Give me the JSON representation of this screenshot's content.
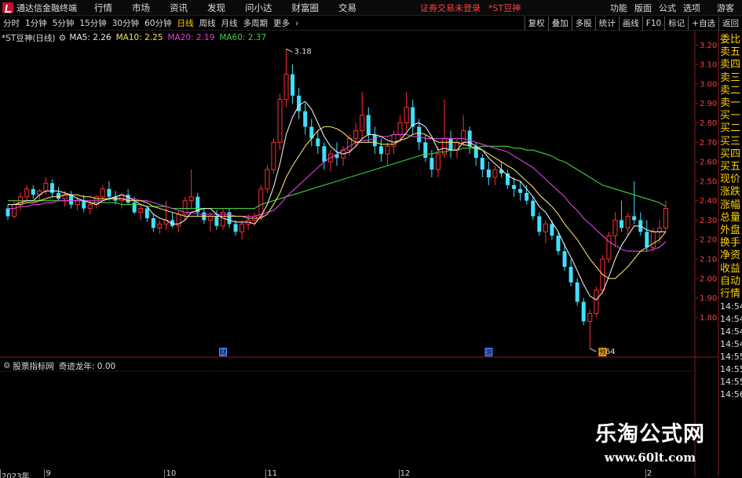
{
  "menubar": {
    "app_title": "通达信金融终端",
    "items": [
      "行情",
      "市场",
      "资讯",
      "发现",
      "问小达",
      "财富圈",
      "交易"
    ],
    "status_msg": "证券交易未登录",
    "stock_title": "*ST豆神",
    "right_items": [
      "功能",
      "版面",
      "公式",
      "选项"
    ],
    "guest": "游客"
  },
  "toolbar": {
    "periods": [
      "分时",
      "1分钟",
      "5分钟",
      "15分钟",
      "30分钟",
      "60分钟",
      "日线",
      "周线",
      "月线",
      "多周期",
      "更多"
    ],
    "active_period": "日线",
    "right_buttons": [
      "复权",
      "叠加",
      "多股",
      "统计",
      "画线",
      "F10",
      "标记",
      "+自选",
      "返回"
    ]
  },
  "legend": {
    "code": "*ST豆神(日线)",
    "ma5_label": "MA5: 2.26",
    "ma10_label": "MA10: 2.25",
    "ma20_label": "MA20: 2.19",
    "ma60_label": "MA60: 2.37",
    "ma5_color": "#e8e8e8",
    "ma10_color": "#f0e060",
    "ma20_color": "#e040e0",
    "ma60_color": "#40d040"
  },
  "indicator": {
    "name": "股票指标网",
    "label": "奇迹龙年: 0.00"
  },
  "sidebar": {
    "items": [
      "委比",
      "卖五",
      "卖四",
      "卖三",
      "卖二",
      "卖一",
      "买一",
      "买二",
      "买三",
      "买四",
      "买五",
      "现价",
      "涨跌",
      "涨幅",
      "总量",
      "外盘",
      "换手",
      "净资",
      "收益",
      "自动",
      "行情"
    ],
    "times": [
      "14:54",
      "14:54",
      "14:54",
      "14:54",
      "14:55",
      "14:55",
      "14:55",
      "14:56"
    ]
  },
  "watermark": {
    "title": "乐淘公式网",
    "url": "www.60lt.com"
  },
  "chart_data": {
    "type": "candlestick",
    "ylim": [
      1.62,
      3.25
    ],
    "y_ticks": [
      "3.20",
      "3.10",
      "3.00",
      "2.90",
      "2.80",
      "2.70",
      "2.60",
      "2.50",
      "2.40",
      "2.30",
      "2.20",
      "2.10",
      "2.00",
      "1.90",
      "1.80"
    ],
    "y_tick_values": [
      3.2,
      3.1,
      3.0,
      2.9,
      2.8,
      2.7,
      2.6,
      2.5,
      2.4,
      2.3,
      2.2,
      2.1,
      2.0,
      1.9,
      1.8
    ],
    "indicator_ticks": [
      "",
      "",
      "",
      ""
    ],
    "annotations": {
      "high": "3.18",
      "low": "1.64"
    },
    "event_markers": [
      {
        "index": 34,
        "label": "财",
        "color": "#4080ff"
      },
      {
        "index": 76,
        "label": "游",
        "color": "#4080ff"
      },
      {
        "index": 94,
        "label": "预",
        "color": "#ffb000"
      }
    ],
    "date_labels": [
      {
        "index": 0,
        "label": "2023年"
      },
      {
        "index": 6,
        "label": "9"
      },
      {
        "index": 25,
        "label": "10"
      },
      {
        "index": 41,
        "label": "11"
      },
      {
        "index": 62,
        "label": "12"
      },
      {
        "index": 101,
        "label": "2"
      }
    ],
    "ohlc": [
      [
        2.36,
        2.38,
        2.3,
        2.32
      ],
      [
        2.32,
        2.4,
        2.31,
        2.38
      ],
      [
        2.38,
        2.44,
        2.35,
        2.42
      ],
      [
        2.42,
        2.48,
        2.4,
        2.46
      ],
      [
        2.46,
        2.48,
        2.41,
        2.43
      ],
      [
        2.43,
        2.46,
        2.4,
        2.45
      ],
      [
        2.45,
        2.52,
        2.43,
        2.49
      ],
      [
        2.49,
        2.51,
        2.42,
        2.44
      ],
      [
        2.44,
        2.47,
        2.4,
        2.41
      ],
      [
        2.41,
        2.45,
        2.37,
        2.43
      ],
      [
        2.43,
        2.45,
        2.36,
        2.38
      ],
      [
        2.38,
        2.42,
        2.35,
        2.4
      ],
      [
        2.4,
        2.43,
        2.34,
        2.36
      ],
      [
        2.36,
        2.4,
        2.33,
        2.38
      ],
      [
        2.38,
        2.43,
        2.36,
        2.42
      ],
      [
        2.42,
        2.48,
        2.4,
        2.46
      ],
      [
        2.46,
        2.5,
        2.4,
        2.42
      ],
      [
        2.42,
        2.45,
        2.38,
        2.4
      ],
      [
        2.4,
        2.44,
        2.36,
        2.43
      ],
      [
        2.43,
        2.46,
        2.38,
        2.39
      ],
      [
        2.39,
        2.42,
        2.33,
        2.34
      ],
      [
        2.34,
        2.38,
        2.3,
        2.36
      ],
      [
        2.36,
        2.37,
        2.29,
        2.31
      ],
      [
        2.31,
        2.33,
        2.24,
        2.26
      ],
      [
        2.26,
        2.3,
        2.23,
        2.28
      ],
      [
        2.28,
        2.4,
        2.25,
        2.3
      ],
      [
        2.3,
        2.34,
        2.26,
        2.27
      ],
      [
        2.27,
        2.35,
        2.24,
        2.33
      ],
      [
        2.33,
        2.42,
        2.3,
        2.4
      ],
      [
        2.4,
        2.56,
        2.36,
        2.42
      ],
      [
        2.42,
        2.44,
        2.32,
        2.34
      ],
      [
        2.34,
        2.36,
        2.28,
        2.3
      ],
      [
        2.3,
        2.34,
        2.24,
        2.32
      ],
      [
        2.32,
        2.35,
        2.25,
        2.27
      ],
      [
        2.27,
        2.36,
        2.25,
        2.34
      ],
      [
        2.34,
        2.36,
        2.26,
        2.28
      ],
      [
        2.28,
        2.3,
        2.22,
        2.24
      ],
      [
        2.24,
        2.3,
        2.2,
        2.28
      ],
      [
        2.28,
        2.33,
        2.25,
        2.3
      ],
      [
        2.3,
        2.34,
        2.27,
        2.32
      ],
      [
        2.32,
        2.48,
        2.3,
        2.46
      ],
      [
        2.46,
        2.58,
        2.44,
        2.56
      ],
      [
        2.56,
        2.72,
        2.54,
        2.7
      ],
      [
        2.7,
        2.95,
        2.66,
        2.92
      ],
      [
        2.92,
        3.18,
        2.88,
        3.05
      ],
      [
        3.05,
        3.1,
        2.9,
        2.94
      ],
      [
        2.94,
        2.98,
        2.82,
        2.86
      ],
      [
        2.86,
        2.9,
        2.74,
        2.78
      ],
      [
        2.78,
        2.82,
        2.68,
        2.72
      ],
      [
        2.72,
        2.76,
        2.64,
        2.68
      ],
      [
        2.68,
        2.7,
        2.56,
        2.6
      ],
      [
        2.6,
        2.66,
        2.55,
        2.64
      ],
      [
        2.64,
        2.7,
        2.58,
        2.62
      ],
      [
        2.62,
        2.68,
        2.58,
        2.66
      ],
      [
        2.66,
        2.74,
        2.63,
        2.72
      ],
      [
        2.72,
        2.8,
        2.68,
        2.76
      ],
      [
        2.76,
        2.96,
        2.72,
        2.84
      ],
      [
        2.84,
        2.88,
        2.7,
        2.74
      ],
      [
        2.74,
        2.78,
        2.64,
        2.68
      ],
      [
        2.68,
        2.72,
        2.6,
        2.64
      ],
      [
        2.64,
        2.7,
        2.58,
        2.68
      ],
      [
        2.68,
        2.76,
        2.64,
        2.74
      ],
      [
        2.74,
        2.84,
        2.7,
        2.8
      ],
      [
        2.8,
        2.96,
        2.76,
        2.88
      ],
      [
        2.88,
        2.92,
        2.74,
        2.78
      ],
      [
        2.78,
        2.82,
        2.66,
        2.7
      ],
      [
        2.7,
        2.74,
        2.6,
        2.62
      ],
      [
        2.62,
        2.66,
        2.52,
        2.56
      ],
      [
        2.56,
        2.68,
        2.52,
        2.64
      ],
      [
        2.64,
        2.92,
        2.62,
        2.72
      ],
      [
        2.72,
        2.76,
        2.62,
        2.66
      ],
      [
        2.66,
        2.72,
        2.62,
        2.7
      ],
      [
        2.7,
        2.84,
        2.68,
        2.76
      ],
      [
        2.76,
        2.78,
        2.64,
        2.68
      ],
      [
        2.68,
        2.7,
        2.58,
        2.62
      ],
      [
        2.62,
        2.64,
        2.52,
        2.56
      ],
      [
        2.56,
        2.6,
        2.48,
        2.52
      ],
      [
        2.52,
        2.58,
        2.48,
        2.56
      ],
      [
        2.56,
        2.6,
        2.52,
        2.54
      ],
      [
        2.54,
        2.56,
        2.46,
        2.48
      ],
      [
        2.48,
        2.52,
        2.42,
        2.46
      ],
      [
        2.46,
        2.5,
        2.4,
        2.44
      ],
      [
        2.44,
        2.48,
        2.38,
        2.4
      ],
      [
        2.4,
        2.42,
        2.3,
        2.32
      ],
      [
        2.32,
        2.34,
        2.22,
        2.24
      ],
      [
        2.24,
        2.3,
        2.18,
        2.28
      ],
      [
        2.28,
        2.3,
        2.2,
        2.22
      ],
      [
        2.22,
        2.24,
        2.12,
        2.14
      ],
      [
        2.14,
        2.18,
        2.04,
        2.06
      ],
      [
        2.06,
        2.1,
        1.96,
        1.98
      ],
      [
        1.98,
        2.0,
        1.86,
        1.88
      ],
      [
        1.88,
        1.9,
        1.76,
        1.78
      ],
      [
        1.78,
        1.84,
        1.64,
        1.82
      ],
      [
        1.82,
        1.96,
        1.8,
        1.94
      ],
      [
        1.94,
        2.12,
        1.92,
        2.1
      ],
      [
        2.1,
        2.24,
        2.08,
        2.22
      ],
      [
        2.22,
        2.34,
        2.16,
        2.3
      ],
      [
        2.3,
        2.4,
        2.24,
        2.26
      ],
      [
        2.26,
        2.34,
        2.22,
        2.32
      ],
      [
        2.32,
        2.5,
        2.28,
        2.3
      ],
      [
        2.3,
        2.34,
        2.22,
        2.24
      ],
      [
        2.24,
        2.3,
        2.14,
        2.16
      ],
      [
        2.16,
        2.26,
        2.14,
        2.24
      ],
      [
        2.24,
        2.3,
        2.18,
        2.26
      ],
      [
        2.26,
        2.4,
        2.24,
        2.36
      ]
    ],
    "ma5": [
      2.38,
      2.38,
      2.39,
      2.4,
      2.4,
      2.43,
      2.45,
      2.45,
      2.45,
      2.44,
      2.43,
      2.41,
      2.4,
      2.39,
      2.38,
      2.4,
      2.41,
      2.42,
      2.43,
      2.42,
      2.4,
      2.38,
      2.37,
      2.33,
      2.31,
      2.3,
      2.28,
      2.28,
      2.3,
      2.34,
      2.35,
      2.36,
      2.36,
      2.33,
      2.31,
      2.3,
      2.29,
      2.29,
      2.29,
      2.28,
      2.32,
      2.38,
      2.47,
      2.59,
      2.74,
      2.83,
      2.89,
      2.91,
      2.87,
      2.8,
      2.73,
      2.68,
      2.65,
      2.64,
      2.65,
      2.68,
      2.72,
      2.74,
      2.74,
      2.73,
      2.71,
      2.7,
      2.71,
      2.75,
      2.79,
      2.8,
      2.78,
      2.73,
      2.66,
      2.67,
      2.66,
      2.66,
      2.7,
      2.7,
      2.68,
      2.66,
      2.62,
      2.59,
      2.56,
      2.53,
      2.51,
      2.5,
      2.46,
      2.42,
      2.37,
      2.34,
      2.29,
      2.24,
      2.17,
      2.11,
      2.04,
      1.97,
      1.91,
      1.89,
      1.93,
      2.01,
      2.1,
      2.17,
      2.22,
      2.27,
      2.27,
      2.25,
      2.24,
      2.24,
      2.24
    ],
    "ma10": [
      2.38,
      2.38,
      2.38,
      2.39,
      2.39,
      2.4,
      2.41,
      2.42,
      2.42,
      2.43,
      2.43,
      2.43,
      2.42,
      2.42,
      2.41,
      2.41,
      2.41,
      2.41,
      2.41,
      2.4,
      2.4,
      2.4,
      2.39,
      2.37,
      2.36,
      2.35,
      2.34,
      2.33,
      2.32,
      2.32,
      2.32,
      2.32,
      2.32,
      2.32,
      2.32,
      2.32,
      2.32,
      2.32,
      2.31,
      2.31,
      2.31,
      2.33,
      2.38,
      2.44,
      2.52,
      2.58,
      2.63,
      2.68,
      2.72,
      2.76,
      2.78,
      2.78,
      2.77,
      2.75,
      2.72,
      2.7,
      2.7,
      2.7,
      2.7,
      2.69,
      2.69,
      2.69,
      2.71,
      2.72,
      2.74,
      2.75,
      2.74,
      2.72,
      2.7,
      2.7,
      2.7,
      2.7,
      2.69,
      2.68,
      2.67,
      2.66,
      2.64,
      2.62,
      2.6,
      2.58,
      2.56,
      2.53,
      2.5,
      2.47,
      2.43,
      2.4,
      2.37,
      2.33,
      2.28,
      2.24,
      2.2,
      2.15,
      2.1,
      2.06,
      2.02,
      2.0,
      2.0,
      2.03,
      2.06,
      2.1,
      2.14,
      2.16,
      2.18,
      2.2,
      2.24
    ],
    "ma20": [
      2.36,
      2.36,
      2.37,
      2.37,
      2.38,
      2.38,
      2.39,
      2.39,
      2.4,
      2.4,
      2.4,
      2.4,
      2.4,
      2.4,
      2.4,
      2.4,
      2.41,
      2.41,
      2.41,
      2.41,
      2.41,
      2.4,
      2.4,
      2.39,
      2.38,
      2.37,
      2.36,
      2.35,
      2.34,
      2.34,
      2.33,
      2.33,
      2.33,
      2.33,
      2.33,
      2.33,
      2.32,
      2.32,
      2.32,
      2.32,
      2.33,
      2.34,
      2.35,
      2.38,
      2.42,
      2.45,
      2.48,
      2.51,
      2.54,
      2.57,
      2.6,
      2.62,
      2.64,
      2.66,
      2.68,
      2.7,
      2.71,
      2.71,
      2.72,
      2.73,
      2.73,
      2.74,
      2.74,
      2.74,
      2.73,
      2.73,
      2.72,
      2.72,
      2.72,
      2.72,
      2.72,
      2.72,
      2.72,
      2.71,
      2.7,
      2.69,
      2.68,
      2.67,
      2.66,
      2.65,
      2.63,
      2.61,
      2.59,
      2.57,
      2.54,
      2.51,
      2.48,
      2.45,
      2.42,
      2.38,
      2.35,
      2.31,
      2.28,
      2.25,
      2.22,
      2.19,
      2.17,
      2.15,
      2.14,
      2.14,
      2.14,
      2.14,
      2.15,
      2.16,
      2.19
    ],
    "ma60": [
      2.4,
      2.4,
      2.4,
      2.4,
      2.4,
      2.4,
      2.4,
      2.4,
      2.4,
      2.4,
      2.4,
      2.4,
      2.4,
      2.39,
      2.39,
      2.39,
      2.39,
      2.39,
      2.38,
      2.38,
      2.38,
      2.38,
      2.37,
      2.37,
      2.37,
      2.37,
      2.36,
      2.36,
      2.36,
      2.36,
      2.36,
      2.36,
      2.36,
      2.36,
      2.36,
      2.36,
      2.36,
      2.36,
      2.36,
      2.36,
      2.38,
      2.39,
      2.4,
      2.41,
      2.42,
      2.43,
      2.44,
      2.45,
      2.46,
      2.47,
      2.48,
      2.49,
      2.5,
      2.51,
      2.52,
      2.53,
      2.54,
      2.55,
      2.56,
      2.57,
      2.58,
      2.59,
      2.6,
      2.61,
      2.62,
      2.63,
      2.64,
      2.64,
      2.65,
      2.65,
      2.66,
      2.66,
      2.67,
      2.67,
      2.67,
      2.68,
      2.68,
      2.68,
      2.68,
      2.68,
      2.67,
      2.67,
      2.66,
      2.66,
      2.65,
      2.64,
      2.63,
      2.61,
      2.6,
      2.58,
      2.56,
      2.54,
      2.52,
      2.5,
      2.48,
      2.47,
      2.46,
      2.45,
      2.44,
      2.43,
      2.42,
      2.41,
      2.4,
      2.39,
      2.37
    ]
  }
}
